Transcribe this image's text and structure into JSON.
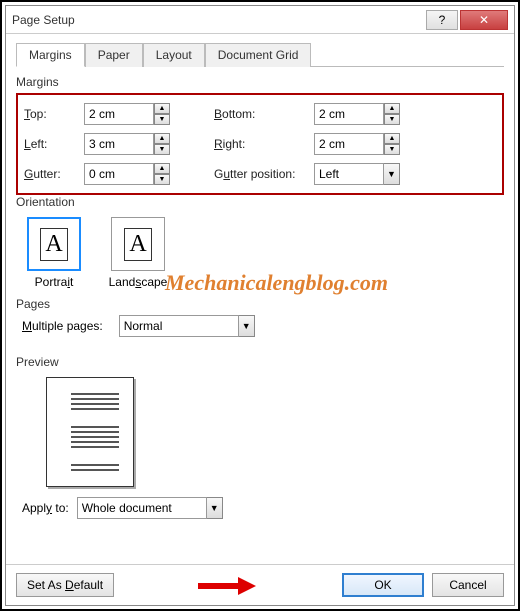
{
  "title": "Page Setup",
  "tabs": {
    "margins": "Margins",
    "paper": "Paper",
    "layout": "Layout",
    "grid": "Document Grid"
  },
  "section": {
    "margins": "Margins",
    "orientation": "Orientation",
    "pages": "Pages",
    "preview": "Preview"
  },
  "margins": {
    "top_label": "Top:",
    "top_val": "2 cm",
    "bottom_label": "Bottom:",
    "bottom_val": "2 cm",
    "left_label": "Left:",
    "left_val": "3 cm",
    "right_label": "Right:",
    "right_val": "2 cm",
    "gutter_label": "Gutter:",
    "gutter_val": "0 cm",
    "gutterpos_label": "Gutter position:",
    "gutterpos_val": "Left"
  },
  "orient": {
    "portrait": "Portrait",
    "landscape": "Landscape",
    "glyph": "A"
  },
  "pages": {
    "label": "Multiple pages:",
    "value": "Normal"
  },
  "apply": {
    "label": "Apply to:",
    "value": "Whole document"
  },
  "footer": {
    "setdef": "Set As Default",
    "ok": "OK",
    "cancel": "Cancel"
  },
  "watermark": "Mechanicalengblog.com",
  "titlebar": {
    "help": "?",
    "close": "✕"
  }
}
